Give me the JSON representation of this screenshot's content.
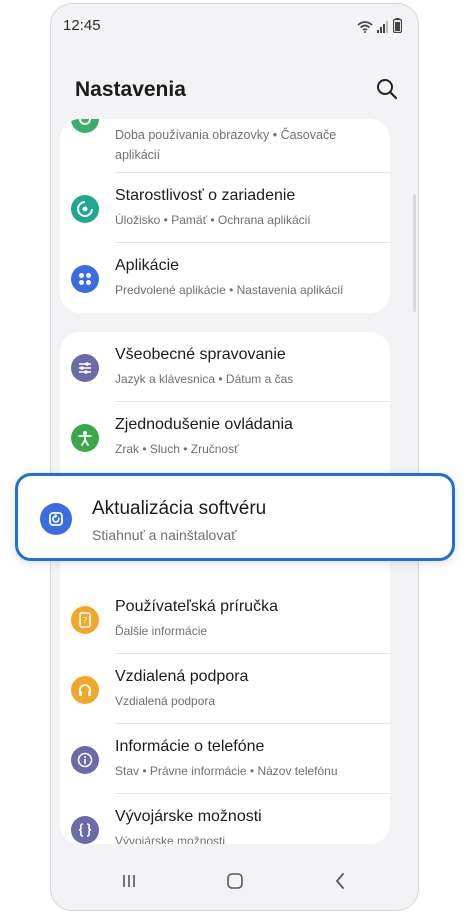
{
  "status_bar": {
    "time": "12:45"
  },
  "header": {
    "title": "Nastavenia",
    "search_icon": "search-icon"
  },
  "group1": {
    "partial_item": {
      "subtitle": "Doba používania obrazovky • Časovače aplikácií",
      "icon_color": "#3aae6a"
    },
    "items": [
      {
        "title": "Starostlivosť o zariadenie",
        "subtitle": "Úložisko • Pamäť • Ochrana aplikácií",
        "icon": "device-care-icon",
        "icon_color": "#1fa88f"
      },
      {
        "title": "Aplikácie",
        "subtitle": "Predvolené aplikácie • Nastavenia aplikácií",
        "icon": "apps-icon",
        "icon_color": "#3a6de0"
      }
    ]
  },
  "group2": {
    "items": [
      {
        "title": "Všeobecné spravovanie",
        "subtitle": "Jazyk a klávesnica • Dátum a čas",
        "icon": "sliders-icon",
        "icon_color": "#6b6ba8"
      },
      {
        "title": "Zjednodušenie ovládania",
        "subtitle": "Zrak • Sluch • Zručnosť",
        "icon": "accessibility-icon",
        "icon_color": "#3aa84a"
      },
      {
        "title": "Aktualizácia softvéru",
        "subtitle": "Stiahnuť a nainštalovať",
        "icon": "software-update-icon",
        "icon_color": "#3a6de0"
      },
      {
        "title": "Používateľská príručka",
        "subtitle": "Ďalšie informácie",
        "icon": "user-manual-icon",
        "icon_color": "#f2a72a"
      },
      {
        "title": "Vzdialená podpora",
        "subtitle": "Vzdialená podpora",
        "icon": "headset-icon",
        "icon_color": "#f2a72a"
      },
      {
        "title": "Informácie o telefóne",
        "subtitle": "Stav • Právne informácie • Názov telefónu",
        "icon": "info-icon",
        "icon_color": "#6b6ba8"
      },
      {
        "title": "Vývojárske možnosti",
        "subtitle": "Vývojárske možnosti",
        "icon": "developer-icon",
        "icon_color": "#6b6ba8"
      }
    ]
  },
  "highlight_color": "#1f6fd8",
  "nav": {
    "recents": "recents-icon",
    "home": "home-icon",
    "back": "back-icon"
  }
}
